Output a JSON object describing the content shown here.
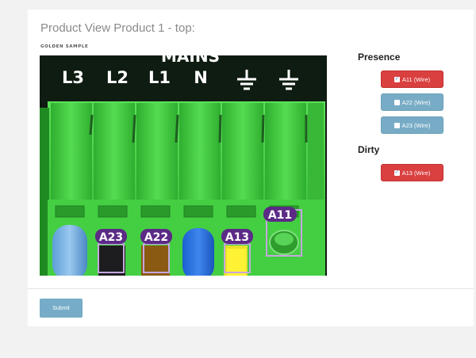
{
  "page": {
    "title": "Product View Product 1 - top:",
    "image_caption": "GOLDEN SAMPLE"
  },
  "photo": {
    "terminal_labels": [
      "L3",
      "L2",
      "L1",
      "N",
      "⏚",
      "⏚"
    ],
    "header_text": "MAINS",
    "regions": [
      "A23",
      "A22",
      "A13",
      "A11"
    ]
  },
  "presence": {
    "label": "Presence",
    "items": [
      {
        "label": "A11 (Wire)",
        "checked": true
      },
      {
        "label": "A22 (Wire)",
        "checked": false
      },
      {
        "label": "A23 (Wire)",
        "checked": false
      }
    ]
  },
  "dirty": {
    "label": "Dirty",
    "items": [
      {
        "label": "A13 (Wire)",
        "checked": true
      }
    ]
  },
  "form": {
    "submit_label": "Submit"
  },
  "colors": {
    "checked_tag": "#d9403f",
    "unchecked_tag": "#78acc6",
    "terminal_green": "#3cc83c",
    "region_box": "#b58fd1",
    "region_badge": "#5b2a86"
  }
}
